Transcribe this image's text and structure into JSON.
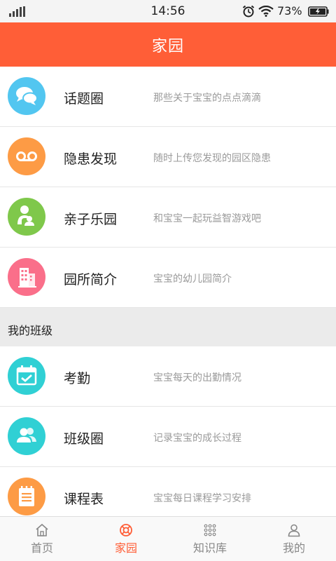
{
  "status_bar": {
    "time": "14:56",
    "battery": "73%"
  },
  "header": {
    "title": "家园"
  },
  "items": [
    {
      "label": "话题圈",
      "desc": "那些关于宝宝的点点滴滴",
      "icon": "chat-bubbles-icon",
      "color": "#52c6f0"
    },
    {
      "label": "隐患发现",
      "desc": "随时上传您发现的园区隐患",
      "icon": "voicemail-icon",
      "color": "#fd9b45"
    },
    {
      "label": "亲子乐园",
      "desc": "和宝宝一起玩益智游戏吧",
      "icon": "parent-child-icon",
      "color": "#7fc84b"
    },
    {
      "label": "园所简介",
      "desc": "宝宝的幼儿园简介",
      "icon": "building-icon",
      "color": "#fa6f8a"
    }
  ],
  "class_section": {
    "title": "我的班级"
  },
  "class_items": [
    {
      "label": "考勤",
      "desc": "宝宝每天的出勤情况",
      "icon": "calendar-check-icon",
      "color": "#30d0d4"
    },
    {
      "label": "班级圈",
      "desc": "记录宝宝的成长过程",
      "icon": "people-icon",
      "color": "#30d0d4"
    },
    {
      "label": "课程表",
      "desc": "宝宝每日课程学习安排",
      "icon": "notepad-icon",
      "color": "#fd9b45"
    }
  ],
  "tabs": [
    {
      "label": "首页",
      "icon": "home-icon",
      "active": false
    },
    {
      "label": "家园",
      "icon": "lifebuoy-icon",
      "active": true
    },
    {
      "label": "知识库",
      "icon": "grid-dots-icon",
      "active": false
    },
    {
      "label": "我的",
      "icon": "person-icon",
      "active": false
    }
  ],
  "colors": {
    "accent": "#ff5e37",
    "tab_inactive": "#888888"
  }
}
